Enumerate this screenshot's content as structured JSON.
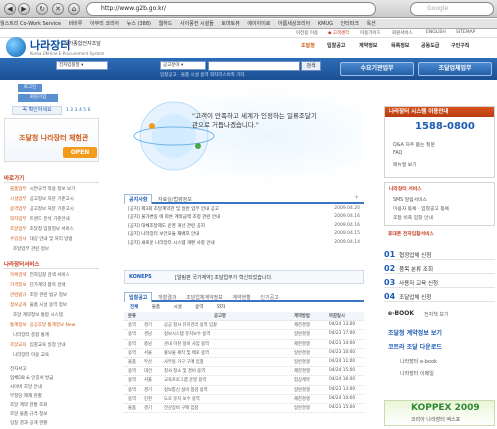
{
  "browser": {
    "url": "http://www.g2b.go.kr/",
    "search_placeholder": "Google",
    "back": "◀",
    "forward": "▶",
    "reload": "↻"
  },
  "favorites": [
    "월스트리 Co-Work Service",
    "비비루",
    "아무리 코리아",
    "뉴스 (388)",
    "웹하드",
    "사이몽컨 시설들",
    "토마토뷰",
    "에이아이로",
    "아름세상코리아",
    "KMUG",
    "인터파크",
    "옥션"
  ],
  "util_links": [
    "이전용 이용",
    "◆ 고객센터",
    "이용가이드",
    "회원서비스",
    "ENGLISH",
    "SITEMAP"
  ],
  "logo": {
    "title": "나라장터",
    "subtitle": "국가종합전자조달",
    "english": "Korea ON-line E-Procurement System"
  },
  "top_menu": [
    "조달청",
    "입찰공고",
    "계약정보",
    "목록정보",
    "공동도급",
    "구인구직"
  ],
  "search": {
    "category": "전자입찰정",
    "type": "공고분야",
    "button": "검색",
    "keywords": "입찰공고  ·  물품 시설 용역 외자리스비축 기타"
  },
  "buttons": {
    "supplier": "수요기관업무",
    "vendor": "조달업체업무"
  },
  "left": {
    "login_label": "로그인",
    "member_label": "회원가입",
    "certificate": "꼭 확인하세요",
    "numbers": [
      "1",
      "2",
      "3",
      "4",
      "5",
      "6"
    ],
    "promo_title": "조달청 나라장터 체험관",
    "promo_badge": "OPEN",
    "section1_title": "바로가기",
    "section1_items": [
      {
        "k": "물품업무",
        "v": "시연규격 적용 정보 보기"
      },
      {
        "k": "시설업무",
        "v": "공고정보 처분 기준고시"
      },
      {
        "k": "용역업무",
        "v": "공고정보 처분 기준고시"
      },
      {
        "k": "외자업무",
        "v": "트렌드 분석 기준안내"
      },
      {
        "k": "조달업무",
        "v": "조달청 입찰정보 서비스"
      },
      {
        "k": "수입검사",
        "v": "대상 안내 및 처리 방법"
      },
      {
        "k": "",
        "v": "조달업무 관련 정보"
      }
    ],
    "section2_title": "나라장터서비스",
    "section2_items": [
      {
        "k": "목록검색",
        "v": "전자입찰 검색 서비스"
      },
      {
        "k": "가격정보",
        "v": "단가계약 품목 검색"
      },
      {
        "k": "관련법규",
        "v": "조달 관련 법규 정보"
      },
      {
        "k": "정보공개",
        "v": "물품 시설 용역 정보"
      },
      {
        "k": "",
        "v": "조달 계약정보 통합 시스템"
      },
      {
        "k": "통계정보",
        "v": "공공조달 통계정보 New"
      },
      {
        "k": "",
        "v": "나라장터 종합 통계"
      },
      {
        "k": "조달교육",
        "v": "입찰교육 일정 안내"
      },
      {
        "k": "",
        "v": "나라장터 이용 교육"
      }
    ],
    "section3_items": [
      "전자서고",
      "업체DB & 인증서 발급",
      "사이버 조달 안내",
      "부정당 제재 현황",
      "조달 계약 현황 조회",
      "조달 물품 규격 정보",
      "입찰 결과 공개 현황"
    ]
  },
  "hero": {
    "quote": "\"고객이 만족하고 세계가 인정하는 일류조달기관으로 거듭나겠습니다.\""
  },
  "notice": {
    "tabs": [
      "공지사항",
      "자료실/법령정보"
    ],
    "more": "+",
    "items": [
      {
        "t": "[공지] 제3회 조달계약관 및 일반 업무 안내 공고",
        "d": "2009.04.20"
      },
      {
        "t": "[공지] 물가변동 에 따른 계약금액 조정 관련 안내",
        "d": "2009.04.16"
      },
      {
        "t": "[공지] 대체조달제도 운영 개선 관련 공지",
        "d": "2009.04.16"
      },
      {
        "t": "[공지] 나라장터 보안모듈 재배포 안내",
        "d": "2009.04.15"
      },
      {
        "t": "[공지] 새로운 나라장터 시스템 개편 사항 안내",
        "d": "2009.04.14"
      }
    ]
  },
  "banner": {
    "label": "KONEPS",
    "text": "[알림판 국가계약] 조달업무가 혁신되었습니다."
  },
  "bid": {
    "tabs": [
      "입찰공고",
      "개찰결과",
      "조달업체계약정보",
      "계약현황",
      "인기공고"
    ],
    "filters": [
      "전체",
      "물품",
      "시설",
      "용역",
      "외자"
    ],
    "headers": [
      "분류",
      "공고명",
      "계약방법",
      "마감일시"
    ],
    "rows": [
      {
        "c": "용역",
        "o": "경기",
        "t": "공공 청사 유지관리 용역 입찰",
        "m": "제한경쟁",
        "d": "04/24 13:00"
      },
      {
        "c": "용역",
        "o": "경남",
        "t": "정보시스템 유지보수 용역",
        "m": "일반경쟁",
        "d": "04/23 17:00"
      },
      {
        "c": "용역",
        "o": "충남",
        "t": "관내 하천 정비 사업 용역",
        "m": "제한경쟁",
        "d": "04/23 14:00"
      },
      {
        "c": "용역",
        "o": "서울",
        "t": "홍보물 제작 및 배포 용역",
        "m": "일반경쟁",
        "d": "04/23 10:00"
      },
      {
        "c": "물품",
        "o": "부산",
        "t": "사무용 가구 구매 입찰",
        "m": "일반경쟁",
        "d": "04/24 11:00"
      },
      {
        "c": "용역",
        "o": "대전",
        "t": "청사 청소 및 경비 용역",
        "m": "제한경쟁",
        "d": "04/24 15:00"
      },
      {
        "c": "용역",
        "o": "서울",
        "t": "교육프로그램 운영 용역",
        "m": "협상계약",
        "d": "04/24 16:00"
      },
      {
        "c": "용역",
        "o": "경기",
        "t": "정보통신 설비 점검 용역",
        "m": "일반경쟁",
        "d": "04/23 13:00"
      },
      {
        "c": "용역",
        "o": "인천",
        "t": "도로 유지 보수 용역",
        "m": "제한경쟁",
        "d": "04/24 10:00"
      },
      {
        "c": "물품",
        "o": "경기",
        "t": "전산장비 구매 입찰",
        "m": "일반경쟁",
        "d": "04/23 15:00"
      }
    ]
  },
  "right": {
    "help_title": "나라장터 시스템 이용안내",
    "phone": "1588-0800",
    "links": [
      "Q&A 자주 묻는 질문",
      "FAQ",
      "매뉴얼 보기"
    ],
    "service_title": "나라장터 서비스",
    "services": [
      "SMS 알림서비스",
      "이용자 등록 · 입찰공고 등록",
      "조달 비축 입찰 안내"
    ],
    "tel_title": "휴대폰 전자입찰서비스",
    "quick": [
      {
        "n": "01",
        "t": "협정업체 신청"
      },
      {
        "n": "02",
        "t": "품목 분류 조회"
      },
      {
        "n": "03",
        "t": "사용자 교육 신청"
      },
      {
        "n": "04",
        "t": "조달업체 신청"
      }
    ],
    "ebook": "e-BOOK",
    "ebook_sub": "전자책 보기",
    "bottom1": "조달청 계약정보 보기",
    "bottom2": "코트라 조달 다운로드",
    "bottom3": "나라장터 e-book",
    "bottom4": "나라장터 이메일",
    "koppex": "KOPPEX 2009",
    "koppex_sub": "코리아 나라장터 엑스포"
  }
}
